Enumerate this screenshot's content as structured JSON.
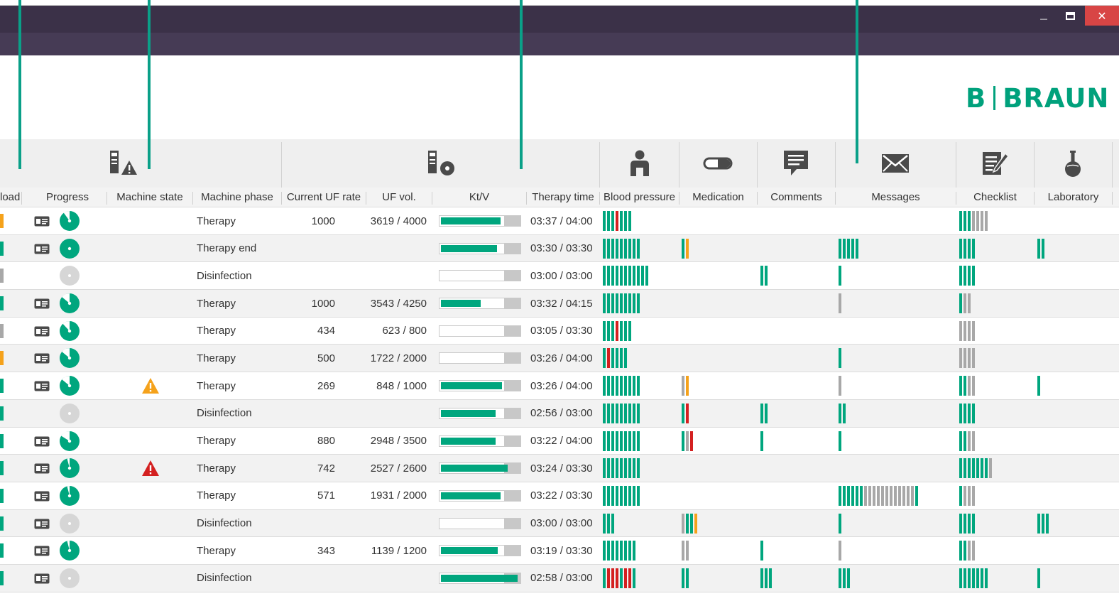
{
  "window": {
    "minimize_glyph": "—",
    "maximize_glyph": "■",
    "close_glyph": "✕"
  },
  "brand": {
    "left": "B",
    "right": "BRAUN",
    "color": "#00a17c"
  },
  "colors": {
    "accent": "#00a67e",
    "alarm": "#d42020",
    "warning": "#f5a21b",
    "neutral": "#a8a8a8",
    "titlebar": "#3b3148"
  },
  "columns": {
    "load": "load",
    "progress": "Progress",
    "machine_state": "Machine state",
    "machine_phase": "Machine phase",
    "current_uf_rate": "Current UF rate",
    "uf_vol": "UF vol.",
    "ktv": "Kt/V",
    "therapy_time": "Therapy time",
    "blood_pressure": "Blood pressure",
    "medication": "Medication",
    "comments": "Comments",
    "messages": "Messages",
    "checklist": "Checklist",
    "laboratory": "Laboratory"
  },
  "icons": {
    "machine_state": "machine-alert-icon",
    "ktv": "machine-disc-icon",
    "blood_pressure": "person-icon",
    "medication": "pill-icon",
    "comments": "speech-bubble-icon",
    "messages": "envelope-icon",
    "checklist": "checklist-icon",
    "laboratory": "flask-icon"
  },
  "rows": [
    {
      "load": "o",
      "card": true,
      "progress": 0.9,
      "active": true,
      "warn": "",
      "phase": "Therapy",
      "uf_rate": "1000",
      "uf_vol": "3619 / 4000",
      "ktv": 0.76,
      "time": "03:37 / 04:00",
      "bp": "gggrggg",
      "med": "",
      "com": "",
      "msg": "",
      "chk": "gggyyyy",
      "lab": ""
    },
    {
      "load": "g",
      "card": true,
      "progress": 1.0,
      "active": true,
      "warn": "",
      "phase": "Therapy end",
      "uf_rate": "",
      "uf_vol": "",
      "ktv": 0.72,
      "time": "03:30 / 03:30",
      "bp": "ggggggggg",
      "med": "go",
      "com": "",
      "msg": "ggggg",
      "chk": "gggg",
      "lab": "gg"
    },
    {
      "load": "y",
      "card": false,
      "progress": 0.0,
      "active": false,
      "warn": "",
      "phase": "Disinfection",
      "uf_rate": "",
      "uf_vol": "",
      "ktv": 0.0,
      "time": "03:00 / 03:00",
      "bp": "ggggggggggg",
      "med": "",
      "com": "gg",
      "msg": "g",
      "chk": "gggg",
      "lab": ""
    },
    {
      "load": "g",
      "card": true,
      "progress": 0.86,
      "active": true,
      "warn": "",
      "phase": "Therapy",
      "uf_rate": "1000",
      "uf_vol": "3543 / 4250",
      "ktv": 0.51,
      "time": "03:32 / 04:15",
      "bp": "ggggggggg",
      "med": "",
      "com": "",
      "msg": "y",
      "chk": "gyy",
      "lab": ""
    },
    {
      "load": "y",
      "card": true,
      "progress": 0.88,
      "active": true,
      "warn": "",
      "phase": "Therapy",
      "uf_rate": "434",
      "uf_vol": "623 / 800",
      "ktv": 0.0,
      "time": "03:05 / 03:30",
      "bp": "gggrggg",
      "med": "",
      "com": "",
      "msg": "",
      "chk": "yyyy",
      "lab": ""
    },
    {
      "load": "o",
      "card": true,
      "progress": 0.86,
      "active": true,
      "warn": "",
      "phase": "Therapy",
      "uf_rate": "500",
      "uf_vol": "1722 / 2000",
      "ktv": 0.0,
      "time": "03:26 / 04:00",
      "bp": "grgggg",
      "med": "",
      "com": "",
      "msg": "g",
      "chk": "yyyy",
      "lab": ""
    },
    {
      "load": "g",
      "card": true,
      "progress": 0.86,
      "active": true,
      "warn": "warning",
      "phase": "Therapy",
      "uf_rate": "269",
      "uf_vol": "848 / 1000",
      "ktv": 0.78,
      "time": "03:26 / 04:00",
      "bp": "ggggggggg",
      "med": "yo",
      "com": "",
      "msg": "y",
      "chk": "ggyy",
      "lab": "g"
    },
    {
      "load": "g",
      "card": false,
      "progress": 0.0,
      "active": false,
      "warn": "",
      "phase": "Disinfection",
      "uf_rate": "",
      "uf_vol": "",
      "ktv": 0.7,
      "time": "02:56 / 03:00",
      "bp": "ggggggggg",
      "med": "gr",
      "com": "gg",
      "msg": "gg",
      "chk": "gggg",
      "lab": ""
    },
    {
      "load": "g",
      "card": true,
      "progress": 0.84,
      "active": true,
      "warn": "",
      "phase": "Therapy",
      "uf_rate": "880",
      "uf_vol": "2948 / 3500",
      "ktv": 0.7,
      "time": "03:22 / 04:00",
      "bp": "ggggggggg",
      "med": "gyr",
      "com": "g",
      "msg": "g",
      "chk": "ggyy",
      "lab": ""
    },
    {
      "load": "g",
      "card": true,
      "progress": 0.96,
      "active": true,
      "warn": "alarm",
      "phase": "Therapy",
      "uf_rate": "742",
      "uf_vol": "2527 / 2600",
      "ktv": 0.85,
      "time": "03:24 / 03:30",
      "bp": "ggggggggg",
      "med": "",
      "com": "",
      "msg": "",
      "chk": "gggggggy",
      "lab": ""
    },
    {
      "load": "g",
      "card": true,
      "progress": 0.96,
      "active": true,
      "warn": "",
      "phase": "Therapy",
      "uf_rate": "571",
      "uf_vol": "1931 / 2000",
      "ktv": 0.76,
      "time": "03:22 / 03:30",
      "bp": "ggggggggg",
      "med": "",
      "com": "",
      "msg": "ggggggyyyyyyyyyyyyg",
      "chk": "gyyy",
      "lab": ""
    },
    {
      "load": "g",
      "card": true,
      "progress": 0.0,
      "active": false,
      "warn": "",
      "phase": "Disinfection",
      "uf_rate": "",
      "uf_vol": "",
      "ktv": 0.0,
      "time": "03:00 / 03:00",
      "bp": "ggg",
      "med": "yggo",
      "com": "",
      "msg": "g",
      "chk": "gggg",
      "lab": "ggg"
    },
    {
      "load": "g",
      "card": true,
      "progress": 0.96,
      "active": true,
      "warn": "",
      "phase": "Therapy",
      "uf_rate": "343",
      "uf_vol": "1139 / 1200",
      "ktv": 0.73,
      "time": "03:19 / 03:30",
      "bp": "gggggggg",
      "med": "yy",
      "com": "g",
      "msg": "y",
      "chk": "ggyy",
      "lab": ""
    },
    {
      "load": "g",
      "card": true,
      "progress": 0.0,
      "active": false,
      "warn": "",
      "phase": "Disinfection",
      "uf_rate": "",
      "uf_vol": "",
      "ktv": 0.98,
      "time": "02:58 / 03:00",
      "bp": "grrrgrrg",
      "med": "gg",
      "com": "ggg",
      "msg": "ggg",
      "chk": "ggggggg",
      "lab": "g"
    }
  ]
}
